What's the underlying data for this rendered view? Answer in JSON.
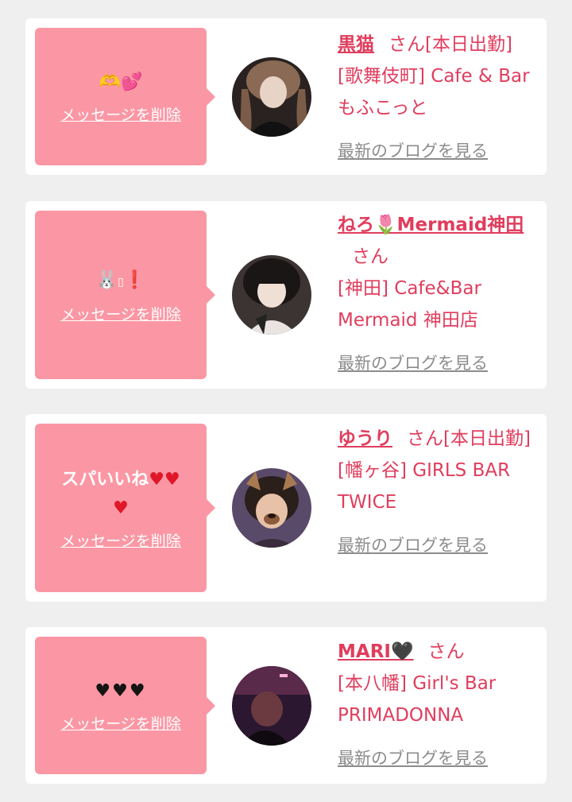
{
  "colors": {
    "page_bg": "#efefef",
    "card_bg": "#ffffff",
    "bubble": "#fb97a4",
    "accent": "#e03d5d",
    "link_gray": "#8c8c8c"
  },
  "cards": [
    {
      "message_icons": [
        "handshake-heart-icon",
        "two-hearts-icon"
      ],
      "delete_label": "メッセージを削除",
      "name": "黒猫",
      "suffix": "さん[本日出勤]",
      "shop": "[歌舞伎町] Cafe & Bar もふこっと",
      "blog_label": "最新のブログを見る"
    },
    {
      "message_icons": [
        "rabbit-face-icon",
        "missing-glyph-icon",
        "exclamation-icon"
      ],
      "delete_label": "メッセージを削除",
      "name": "ねろ🌷Mermaid神田",
      "suffix": "さん",
      "shop": "[神田] Cafe&Bar Mermaid 神田店",
      "blog_label": "最新のブログを見る"
    },
    {
      "message_text": "スパいいね",
      "message_icons": [
        "red-heart-icon",
        "red-heart-icon",
        "red-heart-icon"
      ],
      "delete_label": "メッセージを削除",
      "name": "ゆうり",
      "suffix": "さん[本日出勤]",
      "shop": "[幡ヶ谷] GIRLS BAR TWICE",
      "blog_label": "最新のブログを見る"
    },
    {
      "message_icons": [
        "black-heart-icon",
        "black-heart-icon",
        "black-heart-icon"
      ],
      "delete_label": "メッセージを削除",
      "name": "MARI🖤",
      "suffix": "さん",
      "shop": "[本八幡] Girl's Bar PRIMADONNA",
      "blog_label": "最新のブログを見る"
    }
  ]
}
